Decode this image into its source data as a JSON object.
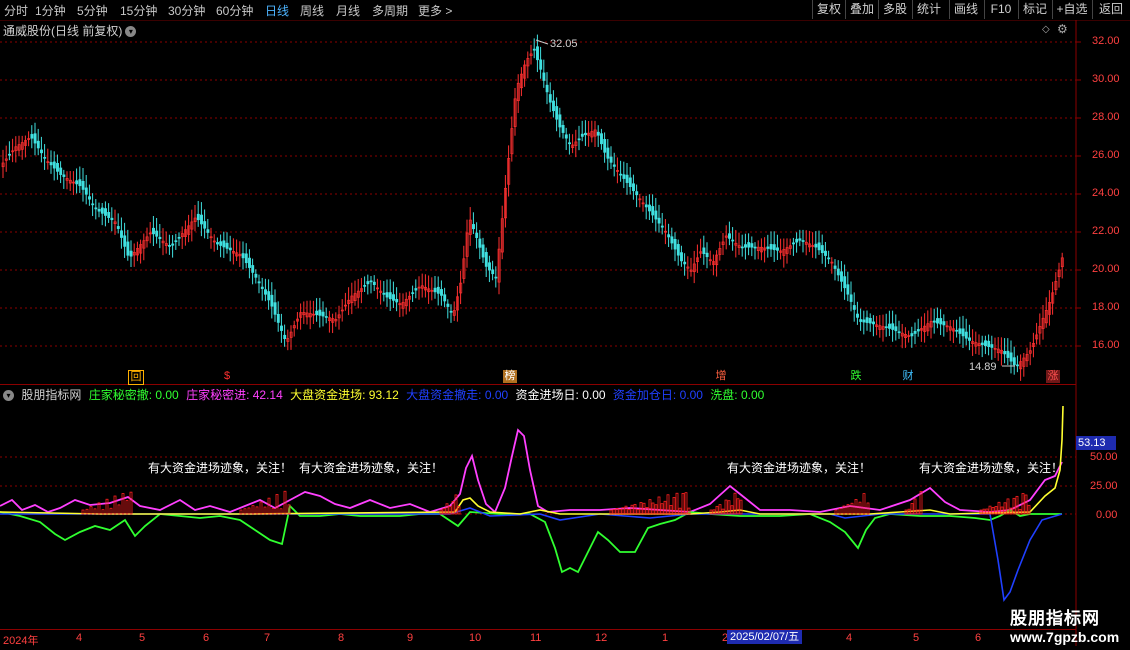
{
  "toolbar": {
    "periods": [
      "分时",
      "1分钟",
      "5分钟",
      "15分钟",
      "30分钟",
      "60分钟",
      "日线",
      "周线",
      "月线",
      "多周期",
      "更多 >"
    ],
    "active_period": "日线",
    "tools": [
      "复权",
      "叠加",
      "多股",
      "统计",
      "画线",
      "F10",
      "标记",
      "+自选",
      "返回"
    ]
  },
  "stock": {
    "title": "通威股份(日线 前复权)",
    "dropdown_icon": "chevron-down-icon"
  },
  "price_axis": {
    "labels": [
      "32.00",
      "30.00",
      "28.00",
      "26.00",
      "24.00",
      "22.00",
      "20.00",
      "18.00",
      "16.00"
    ],
    "min": 14.0,
    "max": 33.0
  },
  "price_annotations": {
    "high": "32.05",
    "low": "14.89"
  },
  "events": [
    {
      "label": "回",
      "color": "#ffb000"
    },
    {
      "label": "$",
      "color": "#ff3030"
    },
    {
      "label": "榜",
      "color": "#ffb000"
    },
    {
      "label": "增",
      "color": "#ff6040"
    },
    {
      "label": "跌",
      "color": "#30ff30"
    },
    {
      "label": "财",
      "color": "#40c0ff"
    },
    {
      "label": "涨",
      "color": "#ff3030"
    }
  ],
  "indicator": {
    "name": "股朋指标网",
    "items": [
      {
        "label": "庄家秘密撤: 0.00",
        "color": "#30ff30"
      },
      {
        "label": "庄家秘密进: 42.14",
        "color": "#ff40ff"
      },
      {
        "label": "大盘资金进场: 93.12",
        "color": "#ffff30"
      },
      {
        "label": "大盘资金撤走: 0.00",
        "color": "#2040ff"
      },
      {
        "label": "资金进场日: 0.00",
        "color": "#ffffff"
      },
      {
        "label": "资金加仓日: 0.00",
        "color": "#2040ff"
      },
      {
        "label": "洗盘: 0.00",
        "color": "#30ff30"
      }
    ],
    "axis_labels": [
      "50.00",
      "25.00",
      "0.00"
    ],
    "current_value": "53.13",
    "annotations": [
      "有大资金进场迹象，关注！",
      "有大资金进场迹象，关注！",
      "有大资金进场迹象，关注！",
      "有大资金进场迹象，关注！"
    ]
  },
  "date_axis": {
    "labels": [
      "2024年",
      "4",
      "5",
      "6",
      "7",
      "8",
      "9",
      "10",
      "11",
      "12",
      "1",
      "2",
      "3",
      "4",
      "5",
      "6"
    ],
    "cursor": "2025/02/07/五"
  },
  "watermark": {
    "line1": "股朋指标网",
    "line2": "www.7gpzb.com"
  },
  "colors": {
    "up": "#ff3030",
    "down": "#40e0e0",
    "axis": "#8b0000",
    "magenta": "#ff40ff",
    "green": "#30ff30",
    "yellow": "#ffff30",
    "blue": "#2040ff"
  }
}
